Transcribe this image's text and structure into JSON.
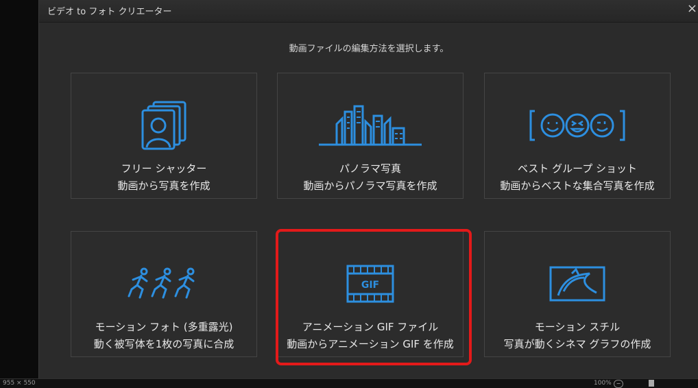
{
  "window": {
    "title": "ビデオ to フォト クリエーター",
    "close_glyph": "×",
    "instruction": "動画ファイルの編集方法を選択します。"
  },
  "accent_color": "#2d8fe0",
  "highlight_color": "#e31a1a",
  "cards": [
    {
      "icon": "person-frames-icon",
      "line1": "フリー シャッター",
      "line2": "動画から写真を作成"
    },
    {
      "icon": "city-skyline-icon",
      "line1": "パノラマ写真",
      "line2": "動画からパノラマ写真を作成"
    },
    {
      "icon": "smiley-faces-icon",
      "line1": "ベスト グループ ショット",
      "line2": "動画からベストな集合写真を作成"
    },
    {
      "icon": "running-figures-icon",
      "line1": "モーション フォト (多重露光)",
      "line2": "動く被写体を1枚の写真に合成"
    },
    {
      "icon": "gif-filmstrip-icon",
      "line1": "アニメーション GIF ファイル",
      "line2": "動画からアニメーション GIF を作成",
      "highlighted": true,
      "icon_text": "GIF"
    },
    {
      "icon": "cinemagraph-icon",
      "line1": "モーション スチル",
      "line2": "写真が動くシネマ グラフの作成"
    }
  ],
  "status": {
    "size": "955 × 550",
    "zoom": "100%",
    "zoom_out_glyph": "−"
  }
}
